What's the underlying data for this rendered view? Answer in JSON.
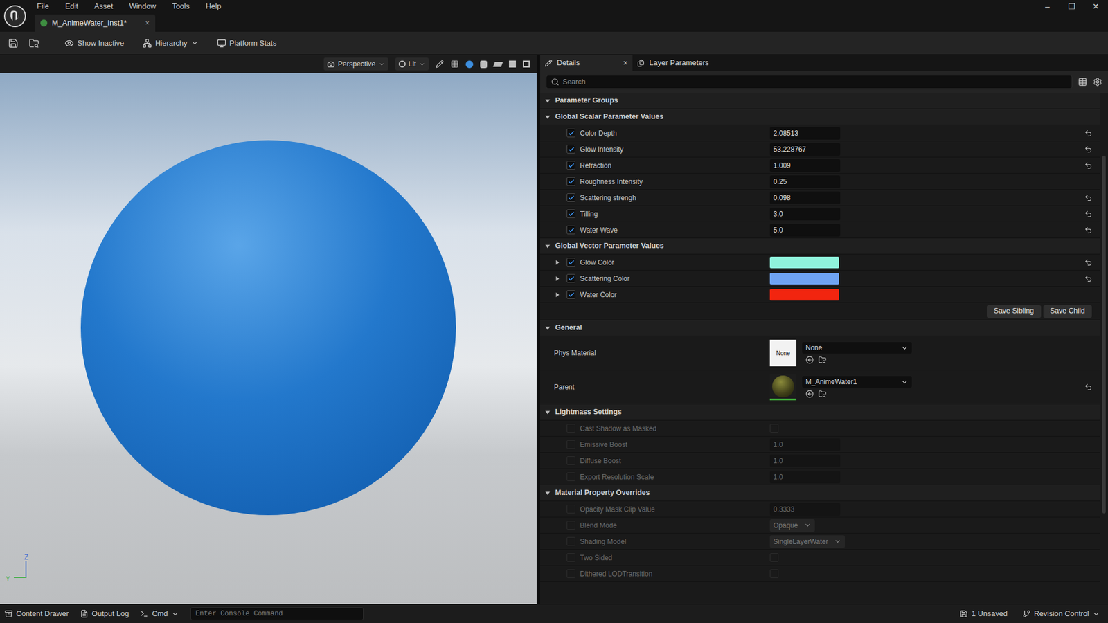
{
  "window": {
    "title": "M_AnimeWater_Inst1*",
    "controls": [
      "–",
      "❐",
      "✕"
    ]
  },
  "menu": [
    "File",
    "Edit",
    "Asset",
    "Window",
    "Tools",
    "Help"
  ],
  "toolbar": {
    "buttons": [
      {
        "label": "Show Inactive",
        "dropdown": false
      },
      {
        "label": "Hierarchy",
        "dropdown": true
      },
      {
        "label": "Platform Stats",
        "dropdown": false
      }
    ]
  },
  "viewport": {
    "buttons": [
      {
        "label": "Perspective"
      },
      {
        "label": "Lit"
      }
    ],
    "axis": [
      "Z",
      "Y"
    ]
  },
  "details": {
    "tabs": [
      {
        "label": "Details",
        "selected": true,
        "close": "×"
      },
      {
        "label": "Layer Parameters",
        "selected": false,
        "close": ""
      }
    ],
    "search": {
      "placeholder": "Search"
    },
    "parameter_groups": {
      "title": "Parameter Groups",
      "expanded": true,
      "scalar": {
        "title": "Global Scalar Parameter Values",
        "expanded": true,
        "params": [
          {
            "name": "Color Depth",
            "checked": true,
            "value": "2.08513",
            "resettable": true
          },
          {
            "name": "Glow Intensity",
            "checked": true,
            "value": "53.228767",
            "resettable": true
          },
          {
            "name": "Refraction",
            "checked": true,
            "value": "1.009",
            "resettable": true
          },
          {
            "name": "Roughness Intensity",
            "checked": true,
            "value": "0.25",
            "resettable": false
          },
          {
            "name": "Scattering strengh",
            "checked": true,
            "value": "0.098",
            "resettable": true
          },
          {
            "name": "Tilling",
            "checked": true,
            "value": "3.0",
            "resettable": true
          },
          {
            "name": "Water Wave",
            "checked": true,
            "value": "5.0",
            "resettable": true
          }
        ]
      },
      "vector": {
        "title": "Global Vector Parameter Values",
        "expanded": true,
        "params": [
          {
            "name": "Glow Color",
            "checked": true,
            "expanded": false,
            "color": "#8ff3dc",
            "resettable": true
          },
          {
            "name": "Scattering Color",
            "checked": true,
            "expanded": false,
            "color": "#6fa3f2",
            "resettable": true
          },
          {
            "name": "Water Color",
            "checked": true,
            "expanded": false,
            "color": "#f2250f",
            "resettable": false
          }
        ]
      },
      "buttons": [
        "Save Sibling",
        "Save Child"
      ]
    },
    "general": {
      "title": "General",
      "expanded": true,
      "phys_material": {
        "label": "Phys Material",
        "thumbnail": "None",
        "value": "None",
        "resettable": false
      },
      "parent": {
        "label": "Parent",
        "value": "M_AnimeWater1",
        "resettable": true
      }
    },
    "lightmass": {
      "title": "Lightmass Settings",
      "expanded": true,
      "rows": [
        {
          "name": "Cast Shadow as Masked",
          "kind": "checkbox",
          "checked": false,
          "disabled": true,
          "value_checked": false
        },
        {
          "name": "Emissive Boost",
          "kind": "number",
          "checked": false,
          "disabled": true,
          "value": "1.0"
        },
        {
          "name": "Diffuse Boost",
          "kind": "number",
          "checked": false,
          "disabled": true,
          "value": "1.0"
        },
        {
          "name": "Export Resolution Scale",
          "kind": "number",
          "checked": false,
          "disabled": true,
          "value": "1.0"
        }
      ]
    },
    "overrides": {
      "title": "Material Property Overrides",
      "expanded": true,
      "rows": [
        {
          "name": "Opacity Mask Clip Value",
          "kind": "number",
          "checked": false,
          "disabled": true,
          "value": "0.3333"
        },
        {
          "name": "Blend Mode",
          "kind": "select",
          "checked": false,
          "disabled": true,
          "value": "Opaque"
        },
        {
          "name": "Shading Model",
          "kind": "select",
          "checked": false,
          "disabled": true,
          "value": "SingleLayerWater"
        },
        {
          "name": "Two Sided",
          "kind": "checkbox",
          "checked": false,
          "disabled": true,
          "value_checked": false
        },
        {
          "name": "Dithered LODTransition",
          "kind": "checkbox",
          "checked": false,
          "disabled": true,
          "value_checked": false
        }
      ]
    }
  },
  "status_bar": {
    "left": [
      {
        "label": "Content Drawer",
        "dropdown": false
      },
      {
        "label": "Output Log",
        "dropdown": false
      },
      {
        "label": "Cmd",
        "dropdown": true
      }
    ],
    "console": {
      "placeholder": "Enter Console Command"
    },
    "right": [
      {
        "label": "1 Unsaved",
        "dropdown": false
      },
      {
        "label": "Revision Control",
        "dropdown": true
      }
    ]
  }
}
